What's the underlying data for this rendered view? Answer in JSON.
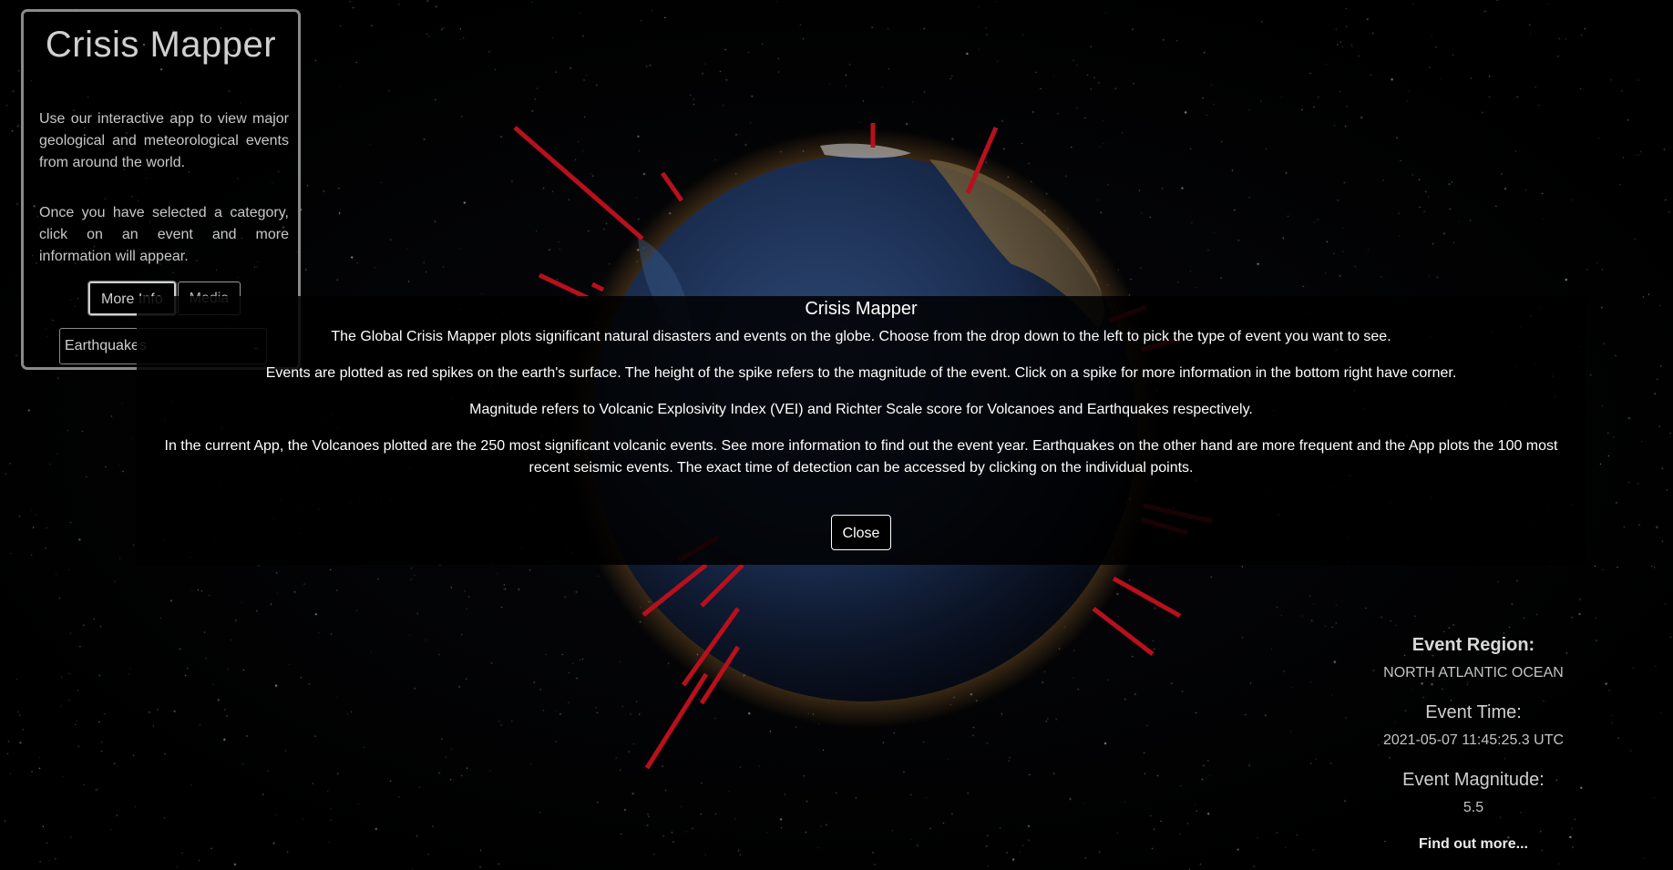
{
  "sidebar": {
    "title": "Crisis Mapper",
    "intro": "Use our interactive app to view major geological and meteorological events from around the world.",
    "instructions": "Once you have selected a category, click on an event and more information will appear.",
    "buttons": {
      "more_info": "More Info",
      "media": "Media"
    },
    "category_select": {
      "selected": "Earthquakes"
    }
  },
  "modal": {
    "title": "Crisis Mapper",
    "paragraphs": [
      "The Global Crisis Mapper plots significant natural disasters and events on the globe. Choose from the drop down to the left to pick the type of event you want to see.",
      "Events are plotted as red spikes on the earth's surface. The height of the spike refers to the magnitude of the event. Click on a spike for more information in the bottom right have corner.",
      "Magnitude refers to Volcanic Explosivity Index (VEI) and Richter Scale score for Volcanoes and Earthquakes respectively.",
      "In the current App, the Volcanoes plotted are the 250 most significant volcanic events. See more information to find out the event year. Earthquakes on the other hand are more frequent and the App plots the 100 most recent seismic events. The exact time of detection can be accessed by clicking on the individual points."
    ],
    "close_label": "Close"
  },
  "event": {
    "region_label": "Event Region:",
    "region_value": "NORTH ATLANTIC OCEAN",
    "time_label": "Event Time:",
    "time_value": "2021-05-07 11:45:25.3 UTC",
    "magnitude_label": "Event Magnitude:",
    "magnitude_value": "5.5",
    "link_label": "Find out more..."
  },
  "colors": {
    "spike": "#b8101c",
    "ocean": "#1a2a48",
    "background": "#000000"
  }
}
